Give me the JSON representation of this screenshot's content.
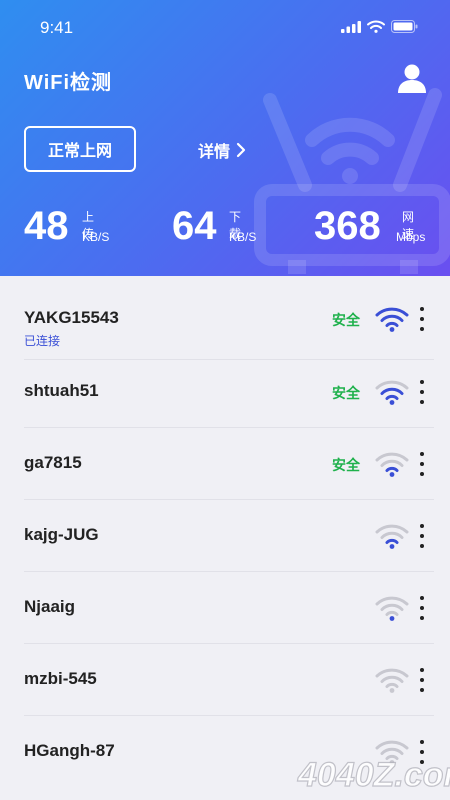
{
  "status_bar": {
    "time": "9:41"
  },
  "app": {
    "title": "WiFi检测"
  },
  "connection": {
    "status_label": "正常上网",
    "details_label": "详情"
  },
  "stats": {
    "upload": {
      "value": "48",
      "label": "上传",
      "unit": "KB/S"
    },
    "download": {
      "value": "64",
      "label": "下载",
      "unit": "KB/S"
    },
    "speed": {
      "value": "368",
      "label": "网速",
      "unit": "Mbps"
    }
  },
  "networks": [
    {
      "ssid": "YAKG15543",
      "status": "已连接",
      "security": "安全",
      "signal_level": 3,
      "color": "#3a4fd6"
    },
    {
      "ssid": "shtuah51",
      "security": "安全",
      "signal_level": 2,
      "color": "#3a4fd6"
    },
    {
      "ssid": "ga7815",
      "security": "安全",
      "signal_level": 1,
      "color": "#3a4fd6"
    },
    {
      "ssid": "kajg-JUG",
      "signal_level": 1,
      "color": "#3a4fd6"
    },
    {
      "ssid": "Njaaig",
      "signal_level": 0,
      "color": "#3a4fd6"
    },
    {
      "ssid": "mzbi-545",
      "signal_level": 0,
      "color": "#c8c8d0"
    },
    {
      "ssid": "HGangh-87",
      "signal_level": 0,
      "color": "#c8c8d0"
    }
  ],
  "watermark": {
    "text": "4040Z.com"
  },
  "icons": [
    "signal-bars-icon",
    "wifi-status-icon",
    "battery-icon",
    "user-icon",
    "chevron-right-icon",
    "wifi-signal-icon",
    "more-vertical-icon",
    "router-icon"
  ],
  "colors": {
    "header_gradient": [
      "#2f8ef0",
      "#6a4ff0"
    ],
    "accent": "#3a4fd6",
    "safe": "#1fb14c",
    "inactive": "#c8c8d0"
  }
}
